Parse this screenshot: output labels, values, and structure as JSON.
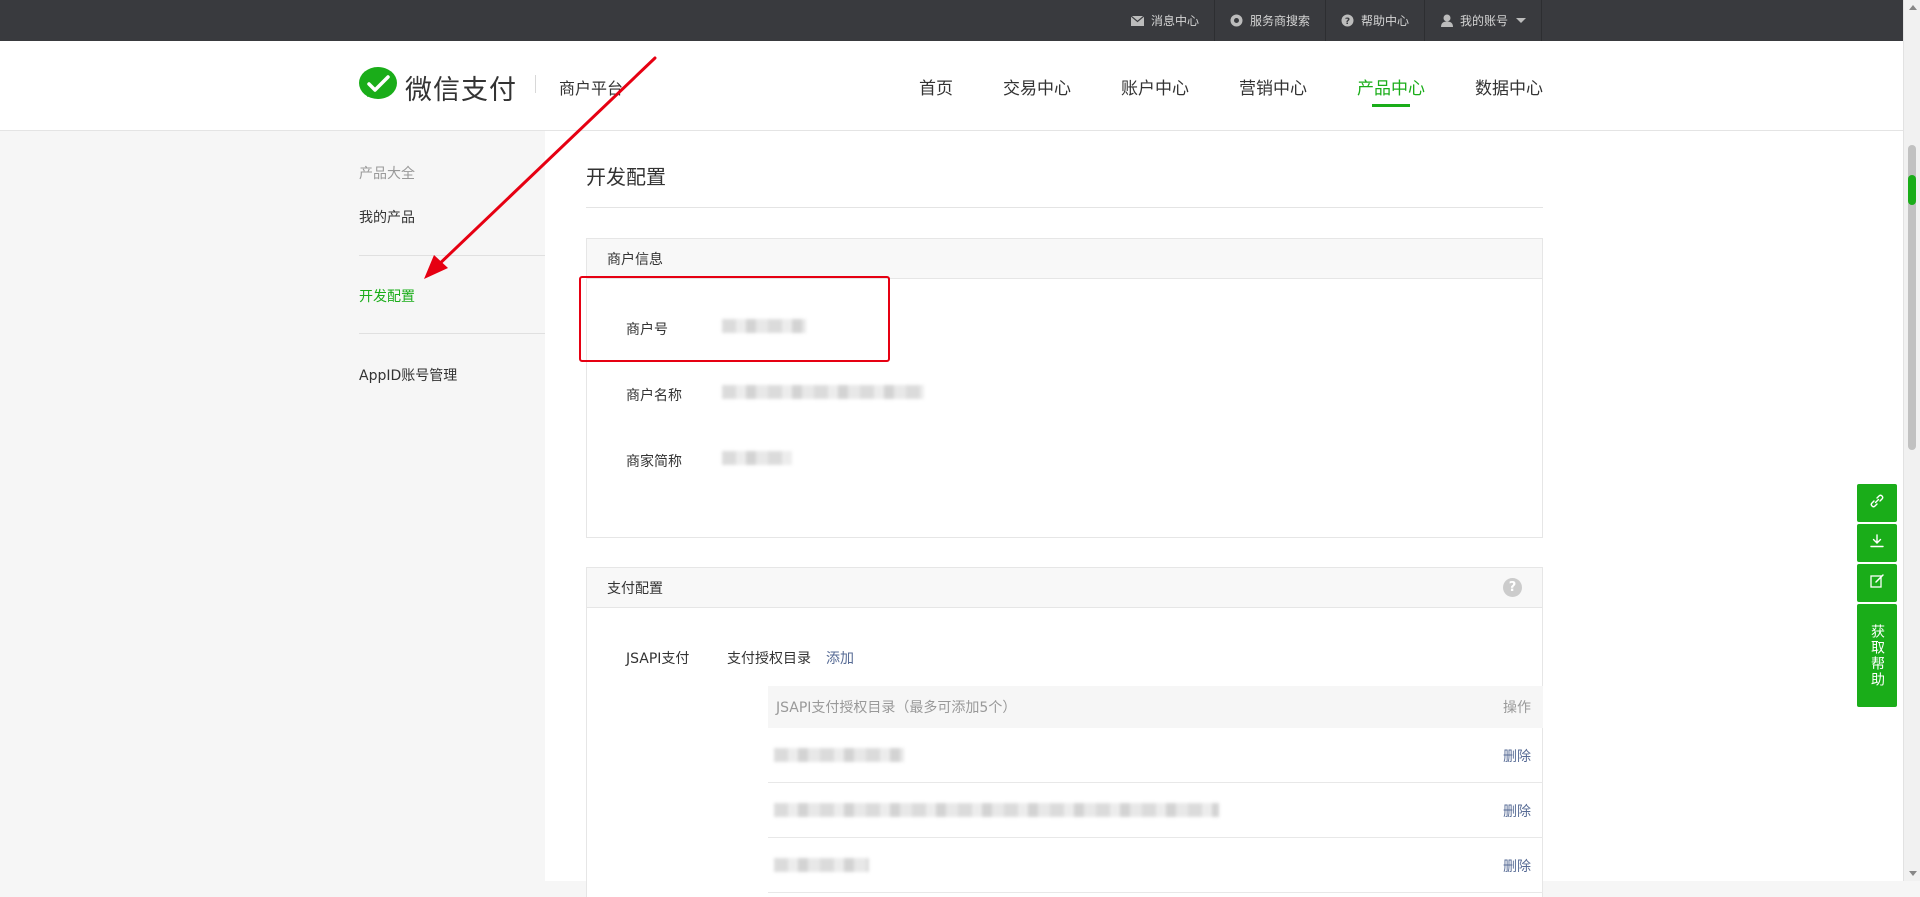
{
  "topbar": {
    "items": [
      {
        "label": "消息中心",
        "icon": "mail-icon"
      },
      {
        "label": "服务商搜索",
        "icon": "search-circle-icon"
      },
      {
        "label": "帮助中心",
        "icon": "question-circle-icon"
      },
      {
        "label": "我的账号",
        "icon": "user-icon"
      }
    ]
  },
  "header": {
    "logo_text": "微信支付",
    "logo_sub": "商户平台",
    "nav": [
      {
        "label": "首页"
      },
      {
        "label": "交易中心"
      },
      {
        "label": "账户中心"
      },
      {
        "label": "营销中心"
      },
      {
        "label": "产品中心",
        "active": true
      },
      {
        "label": "数据中心"
      }
    ]
  },
  "sidebar": {
    "title": "产品大全",
    "items": [
      {
        "label": "我的产品"
      },
      {
        "label": "开发配置",
        "active": true
      },
      {
        "label": "AppID账号管理"
      }
    ]
  },
  "main": {
    "page_title": "开发配置",
    "merchant_panel": {
      "title": "商户信息",
      "rows": [
        {
          "label": "商户号"
        },
        {
          "label": "商户名称"
        },
        {
          "label": "商家简称"
        }
      ]
    },
    "pay_panel": {
      "title": "支付配置",
      "help_symbol": "?",
      "jsapi_label": "JSAPI支付",
      "auth_dir_label": "支付授权目录",
      "add_link": "添加",
      "table": {
        "col_dir": "JSAPI支付授权目录（最多可添加5个）",
        "col_action": "操作",
        "rows": [
          {
            "action": "删除"
          },
          {
            "action": "删除"
          },
          {
            "action": "删除"
          }
        ]
      }
    }
  },
  "float_bar": {
    "help_text": "获取帮助",
    "buttons": [
      "link-icon",
      "download-icon",
      "edit-icon"
    ]
  },
  "colors": {
    "brand_green": "#1aad19",
    "topbar_bg": "#393a3e",
    "annotation_red": "#e60012",
    "link_blue": "#576b95"
  }
}
